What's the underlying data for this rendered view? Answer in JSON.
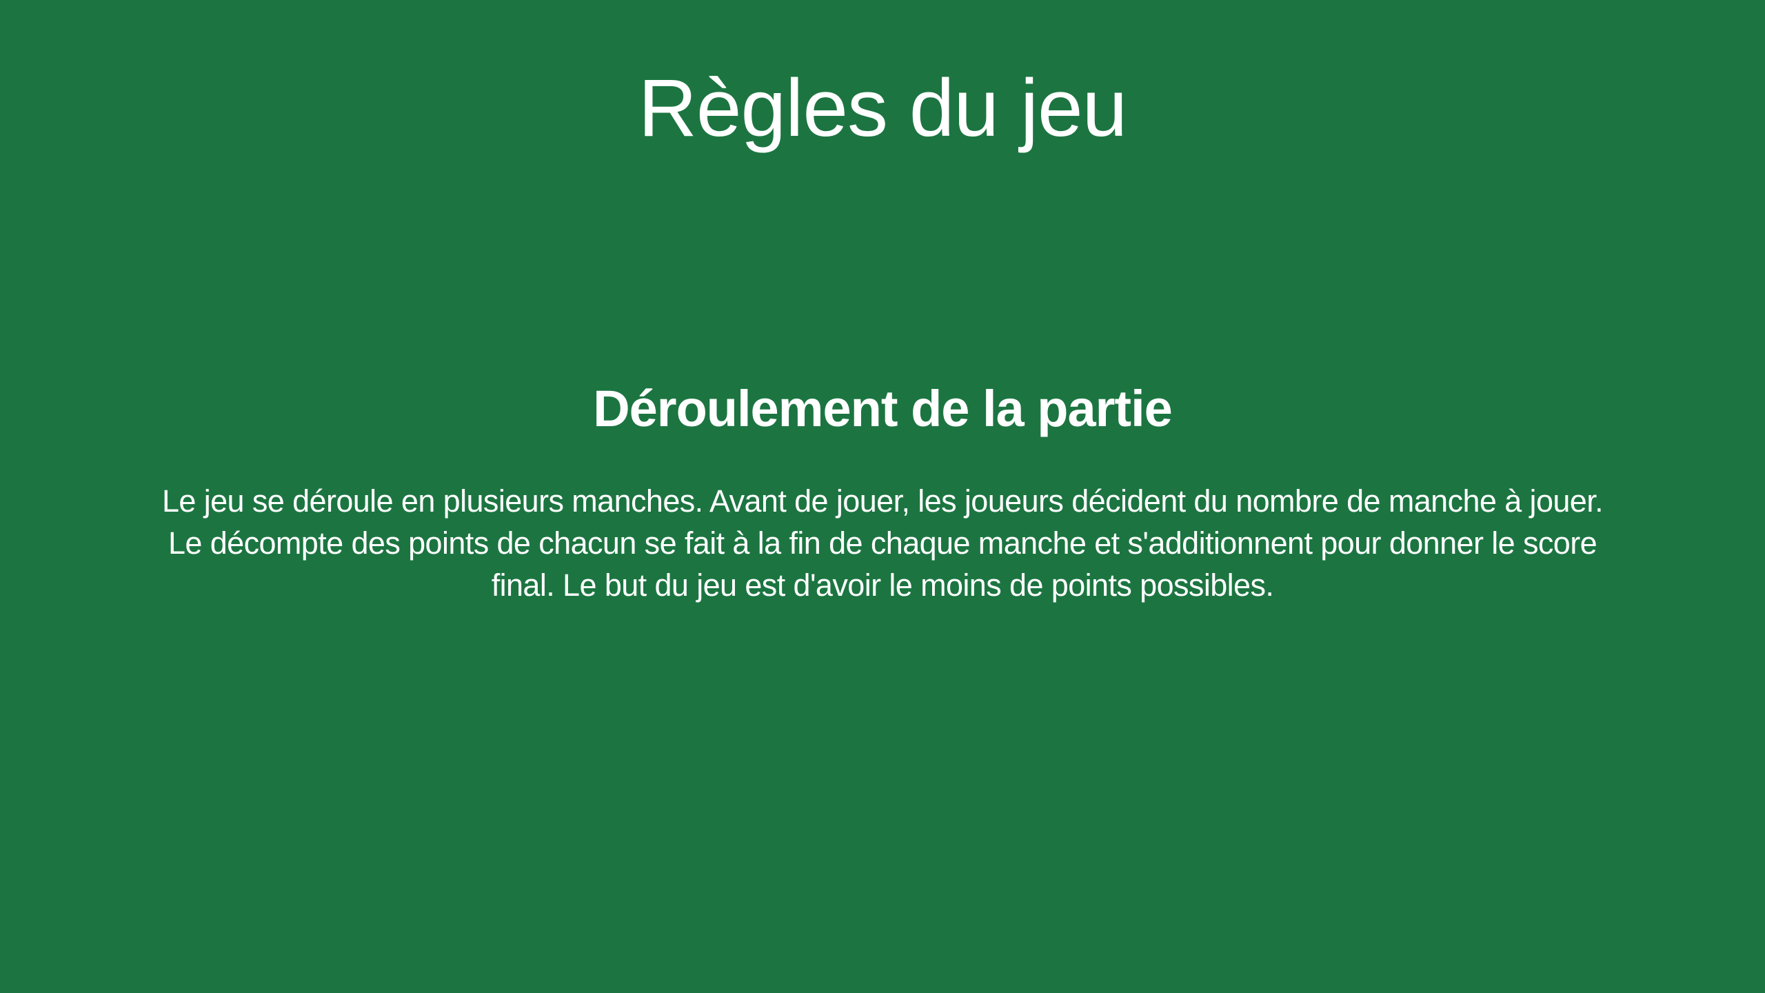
{
  "page": {
    "title": "Règles du jeu",
    "background_color": "#1c7541",
    "text_color": "#ffffff"
  },
  "section": {
    "heading": "Déroulement de la partie",
    "body": "Le jeu se déroule en plusieurs manches. Avant de jouer, les joueurs décident du nombre de manche à jouer. Le décompte des points de chacun se fait à la fin de chaque manche et s'additionnent pour donner le score final. Le but du jeu est d'avoir le moins de points possibles."
  }
}
